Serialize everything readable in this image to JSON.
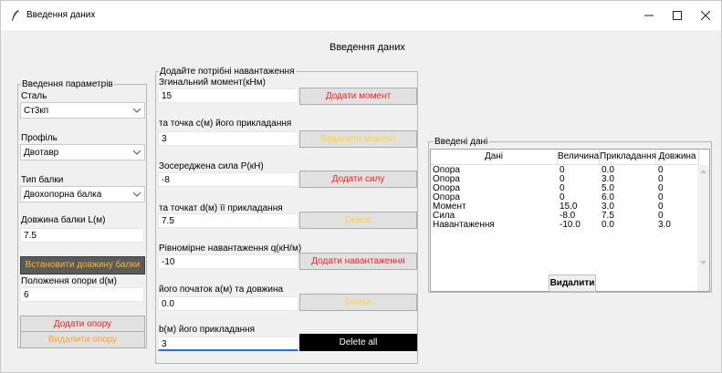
{
  "window": {
    "title": "Введення даних",
    "heading": "Введення даних"
  },
  "params": {
    "frame_title": "Введення параметрів",
    "steel_label": "Сталь",
    "steel_value": "Ст3кп",
    "profile_label": "Профіль",
    "profile_value": "Двотавр",
    "beam_type_label": "Тип балки",
    "beam_type_value": "Двохопорна балка",
    "length_label": "Довжина балки L(м)",
    "length_value": "7.5",
    "set_length_button": "Встановити довжину балки",
    "support_pos_label": "Положення опори d(м)",
    "support_pos_value": "6",
    "add_support_button": "Додати опору",
    "delete_support_button": "Видалити опору"
  },
  "loads": {
    "frame_title": "Додайте потрібні навантаження",
    "moment_label": "Згинальний момент(кНм)",
    "moment_value": "15",
    "add_moment_button": "Додати момент",
    "moment_point_label": "та точка с(м) його прикладання",
    "moment_point_value": "3",
    "delete_moment_button": "Видалити момент",
    "force_label": "Зосереджена сила P(кН)",
    "force_value": "-8",
    "add_force_button": "Додати силу",
    "force_point_label": "та точкат d(м) її прикладання",
    "force_point_value": "7.5",
    "delete_force_button": "Delete",
    "dist_label": "Рівномірне навантаження q(кН/м)",
    "dist_value": "-10",
    "add_dist_button": "Додати навантаження",
    "dist_start_label": "його початок а(м) та довжина",
    "dist_start_value": "0.0",
    "delete_dist_button": "Delete",
    "dist_len_label": "b(м) його прикладання",
    "dist_len_value": "3",
    "delete_all_button": "Delete all"
  },
  "entered": {
    "frame_title": "Введені дані",
    "columns": [
      "Дані",
      "Величина",
      "Прикладання",
      "Довжина"
    ],
    "rows": [
      [
        "Опора",
        "0",
        "0.0",
        "0"
      ],
      [
        "Опора",
        "0",
        "3.0",
        "0"
      ],
      [
        "Опора",
        "0",
        "5.0",
        "0"
      ],
      [
        "Опора",
        "0",
        "6.0",
        "0"
      ],
      [
        "Момент",
        "15.0",
        "3.0",
        "0"
      ],
      [
        "Сила",
        "-8.0",
        "7.5",
        "0"
      ],
      [
        "Навантаження",
        "-10.0",
        "0.0",
        "3.0"
      ]
    ],
    "delete_button": "Видалити"
  },
  "colors": {
    "red_text": "#ff2020",
    "orange_text": "#ffa41c",
    "dark_button": "#5a5a5a",
    "black_button": "#000000"
  }
}
